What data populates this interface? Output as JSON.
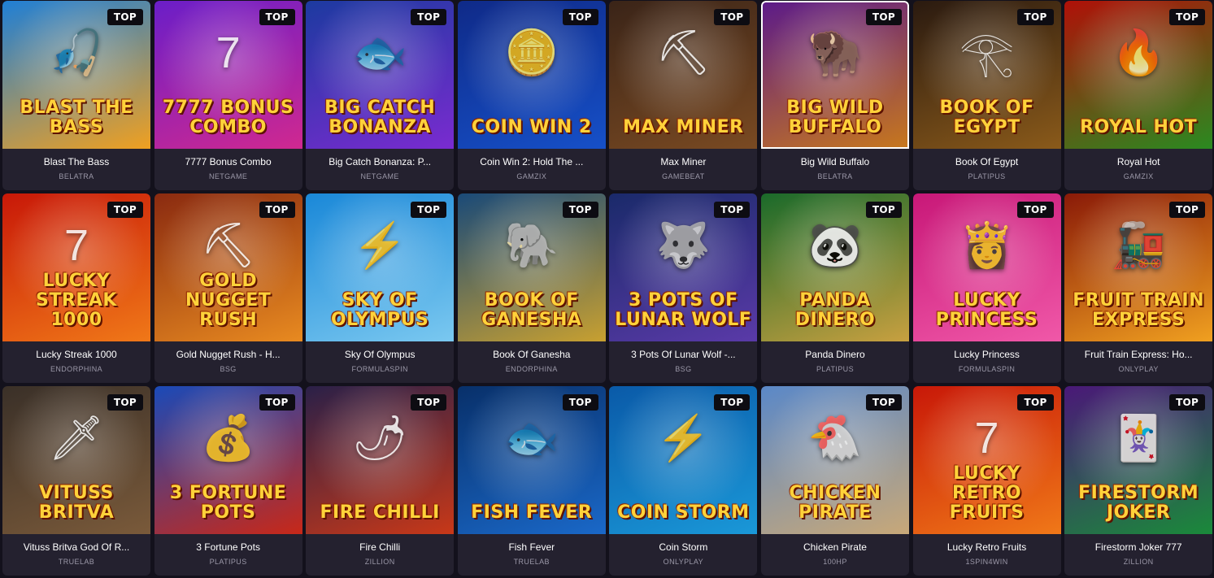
{
  "badge_label": "TOP",
  "games": [
    {
      "title": "Blast The Bass",
      "provider": "BELATRA",
      "logo": "BLAST THE BASS",
      "icon": "fish-icon",
      "glyph": "🎣",
      "bg": [
        "#1f7fd6",
        "#f0a020"
      ]
    },
    {
      "title": "7777 Bonus Combo",
      "provider": "NETGAME",
      "logo": "7777 BONUS COMBO",
      "icon": "seven-icon",
      "glyph": "7",
      "bg": [
        "#6a1ec8",
        "#d02890"
      ]
    },
    {
      "title": "Big Catch Bonanza: P...",
      "provider": "NETGAME",
      "logo": "BIG CATCH BONANZA",
      "icon": "fish-icon",
      "glyph": "🐟",
      "bg": [
        "#1c3aa0",
        "#7a2bd0"
      ]
    },
    {
      "title": "Coin Win 2: Hold The ...",
      "provider": "GAMZIX",
      "logo": "COIN WIN 2",
      "icon": "coin-icon",
      "glyph": "🪙",
      "bg": [
        "#0f2a88",
        "#1650c8"
      ]
    },
    {
      "title": "Max Miner",
      "provider": "GAMEBEAT",
      "logo": "MAX MINER",
      "icon": "miner-icon",
      "glyph": "⛏",
      "bg": [
        "#3a2418",
        "#7a4a22"
      ]
    },
    {
      "title": "Big Wild Buffalo",
      "provider": "BELATRA",
      "logo": "BIG WILD BUFFALO",
      "icon": "buffalo-icon",
      "glyph": "🦬",
      "bg": [
        "#5b1a8a",
        "#c8781c"
      ]
    },
    {
      "title": "Book Of Egypt",
      "provider": "PLATIPUS",
      "logo": "BOOK OF EGYPT",
      "icon": "pharaoh-icon",
      "glyph": "𓂀",
      "bg": [
        "#2a1a10",
        "#8a5a1a"
      ]
    },
    {
      "title": "Royal Hot",
      "provider": "GAMZIX",
      "logo": "ROYAL HOT",
      "icon": "fire-icon",
      "glyph": "🔥",
      "bg": [
        "#b01008",
        "#2a8a20"
      ]
    },
    {
      "title": "Lucky Streak 1000",
      "provider": "ENDORPHINA",
      "logo": "LUCKY STREAK 1000",
      "icon": "seven-icon",
      "glyph": "7",
      "bg": [
        "#c81808",
        "#f07818"
      ]
    },
    {
      "title": "Gold Nugget Rush - H...",
      "provider": "BSG",
      "logo": "GOLD NUGGET RUSH",
      "icon": "miner-icon",
      "glyph": "⛏",
      "bg": [
        "#8a2a10",
        "#e88a20"
      ]
    },
    {
      "title": "Sky Of Olympus",
      "provider": "FORMULASPIN",
      "logo": "SKY OF OLYMPUS",
      "icon": "zeus-icon",
      "glyph": "⚡",
      "bg": [
        "#1a88d8",
        "#7ac8f0"
      ]
    },
    {
      "title": "Book Of Ganesha",
      "provider": "ENDORPHINA",
      "logo": "BOOK OF GANESHA",
      "icon": "elephant-icon",
      "glyph": "🐘",
      "bg": [
        "#1a4a78",
        "#c8a030"
      ]
    },
    {
      "title": "3 Pots Of Lunar Wolf -...",
      "provider": "BSG",
      "logo": "3 POTS OF LUNAR WOLF",
      "icon": "wolf-icon",
      "glyph": "🐺",
      "bg": [
        "#1a2a6a",
        "#5a3aa8"
      ]
    },
    {
      "title": "Panda Dinero",
      "provider": "PLATIPUS",
      "logo": "PANDA DINERO",
      "icon": "panda-icon",
      "glyph": "🐼",
      "bg": [
        "#1a6a2a",
        "#c8a040"
      ]
    },
    {
      "title": "Lucky Princess",
      "provider": "FORMULASPIN",
      "logo": "LUCKY PRINCESS",
      "icon": "princess-icon",
      "glyph": "👸",
      "bg": [
        "#c81878",
        "#f058a8"
      ]
    },
    {
      "title": "Fruit Train Express: Ho...",
      "provider": "ONLYPLAY",
      "logo": "FRUIT TRAIN EXPRESS",
      "icon": "train-icon",
      "glyph": "🚂",
      "bg": [
        "#8a1a08",
        "#f0a020"
      ]
    },
    {
      "title": "Vituss Britva God Of R...",
      "provider": "TRUELAB",
      "logo": "VITUSS BRITVA",
      "icon": "warrior-icon",
      "glyph": "🗡",
      "bg": [
        "#3a3028",
        "#7a5a3a"
      ]
    },
    {
      "title": "3 Fortune Pots",
      "provider": "PLATIPUS",
      "logo": "3 FORTUNE POTS",
      "icon": "fortune-god-icon",
      "glyph": "💰",
      "bg": [
        "#1a4ab8",
        "#c82818"
      ]
    },
    {
      "title": "Fire Chilli",
      "provider": "ZILLION",
      "logo": "FIRE CHILLI",
      "icon": "chilli-icon",
      "glyph": "🌶",
      "bg": [
        "#2a2048",
        "#c83818"
      ]
    },
    {
      "title": "Fish Fever",
      "provider": "TRUELAB",
      "logo": "FISH FEVER",
      "icon": "swordfish-icon",
      "glyph": "🐟",
      "bg": [
        "#08306a",
        "#1a68c8"
      ]
    },
    {
      "title": "Coin Storm",
      "provider": "ONLYPLAY",
      "logo": "COIN STORM",
      "icon": "lightning-icon",
      "glyph": "⚡",
      "bg": [
        "#0a5aa8",
        "#1a98d8"
      ]
    },
    {
      "title": "Chicken Pirate",
      "provider": "100HP",
      "logo": "CHICKEN PIRATE",
      "icon": "chicken-icon",
      "glyph": "🐔",
      "bg": [
        "#5a88c8",
        "#c8a878"
      ]
    },
    {
      "title": "Lucky Retro Fruits",
      "provider": "1SPIN4WIN",
      "logo": "LUCKY RETRO FRUITS",
      "icon": "seven-icon",
      "glyph": "7",
      "bg": [
        "#c81808",
        "#f07818"
      ]
    },
    {
      "title": "Firestorm Joker 777",
      "provider": "ZILLION",
      "logo": "FIRESTORM JOKER",
      "icon": "joker-icon",
      "glyph": "🃏",
      "bg": [
        "#4a1878",
        "#1a8a3a"
      ]
    }
  ]
}
